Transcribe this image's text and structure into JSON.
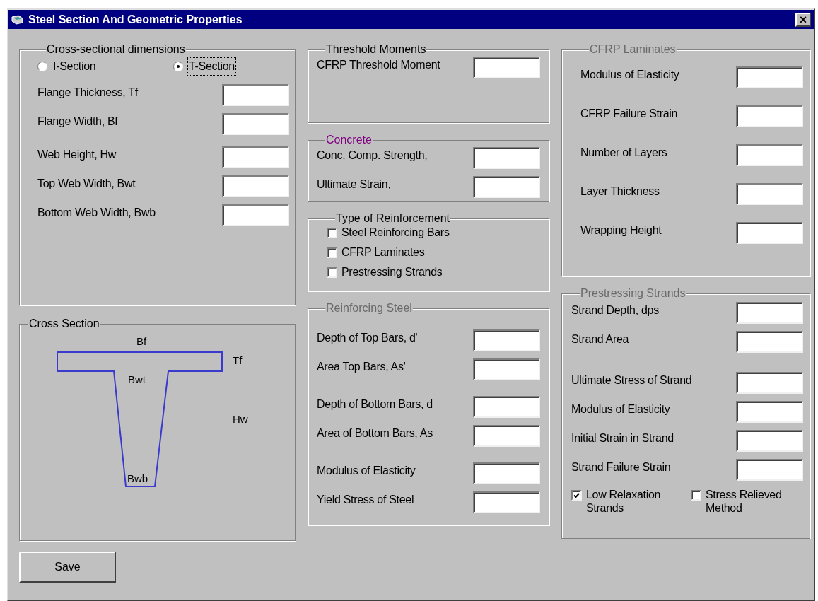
{
  "window": {
    "title": "Steel Section And Geometric Properties",
    "close": "×"
  },
  "cross_sectional_dimensions": {
    "title": "Cross-sectional dimensions",
    "disabled": false,
    "radios": [
      {
        "label": "I-Section",
        "selected": false,
        "focused": false
      },
      {
        "label": "T-Section",
        "selected": true,
        "focused": true
      }
    ],
    "field_groups": [
      [
        {
          "label": "Flange Thickness, Tf"
        },
        {
          "label": "Flange Width, Bf"
        }
      ],
      [
        {
          "label": "Web Height, Hw"
        },
        {
          "label": "Top Web Width, Bwt"
        },
        {
          "label": "Bottom Web Width, Bwb"
        }
      ]
    ]
  },
  "cross_section": {
    "title": "Cross Section",
    "disabled": false,
    "labels": {
      "flange_width": "Bf",
      "flange_thickness": "Tf",
      "top_web_width": "Bwt",
      "web_height": "Hw",
      "bottom_web_width": "Bwb"
    }
  },
  "threshold_moments": {
    "title": "Threshold Moments",
    "disabled": false,
    "fields": [
      {
        "label": "CFRP Threshold Moment"
      }
    ]
  },
  "concrete": {
    "title": "Concrete",
    "disabled": false,
    "color": "#800080",
    "fields": [
      {
        "label": "Conc. Comp. Strength,"
      },
      {
        "label": "Ultimate Strain,"
      }
    ]
  },
  "type_of_reinforcement": {
    "title": "Type of Reinforcement",
    "disabled": false,
    "checkboxes": [
      {
        "label": "Steel Reinforcing Bars",
        "checked": false
      },
      {
        "label": "CFRP Laminates",
        "checked": false
      },
      {
        "label": "Prestressing Strands",
        "checked": false
      }
    ]
  },
  "reinforcing_steel": {
    "title": "Reinforcing Steel",
    "disabled": true,
    "field_groups": [
      [
        {
          "label": "Depth of Top Bars, d'"
        },
        {
          "label": "Area Top Bars, As'"
        }
      ],
      [
        {
          "label": "Depth of Bottom Bars, d"
        },
        {
          "label": "Area of Bottom Bars, As"
        }
      ],
      [
        {
          "label": "Modulus of Elasticity"
        },
        {
          "label": "Yield Stress of Steel"
        }
      ]
    ]
  },
  "cfrp_laminates": {
    "title": "CFRP Laminates",
    "disabled": true,
    "fields": [
      {
        "label": "Modulus of Elasticity"
      },
      {
        "label": "CFRP Failure Strain"
      },
      {
        "label": "Number of Layers"
      },
      {
        "label": "Layer Thickness"
      },
      {
        "label": "Wrapping Height"
      }
    ]
  },
  "prestressing_strands": {
    "title": "Prestressing Strands",
    "disabled": true,
    "field_groups": [
      [
        {
          "label": "Strand Depth, dps"
        },
        {
          "label": "Strand Area"
        }
      ],
      [
        {
          "label": "Ultimate Stress of Strand"
        },
        {
          "label": "Modulus of Elasticity"
        },
        {
          "label": "Initial Strain in Strand"
        },
        {
          "label": "Strand Failure Strain"
        }
      ]
    ],
    "checkboxes": [
      {
        "label": "Low Relaxation Strands",
        "checked": true
      },
      {
        "label": "Stress Relieved Method",
        "checked": false
      }
    ]
  },
  "save_button": "Save"
}
